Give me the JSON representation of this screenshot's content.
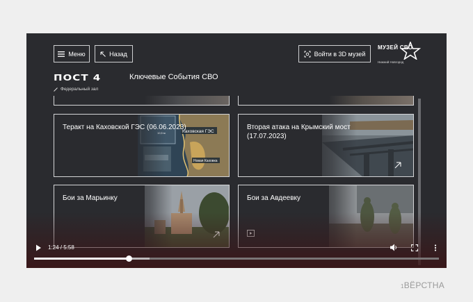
{
  "header": {
    "menu_label": "Меню",
    "back_label": "Назад",
    "museum3d_label": "Войти в 3D музей",
    "logo_text": "МУЗЕЙ СВО",
    "logo_city": "Нижний Новгород"
  },
  "page": {
    "post_title": "ПОСТ 4",
    "section_title": "Ключевые События СВО",
    "hall_label": "Федеральный зал"
  },
  "cards": [
    {
      "label": "Теракт на Каховской ГЭС (06.06.2023)"
    },
    {
      "label": "Вторая атака на Крымский мост (17.07.2023)"
    },
    {
      "label": "Бои за Марьинку"
    },
    {
      "label": "Бои за Авдеевку"
    }
  ],
  "map_labels": {
    "dam": "Каховская ГЭС",
    "city": "Новая Каховка",
    "dist": "10,5 м"
  },
  "player": {
    "time_display": "1:24 / 5:58",
    "progress": 0.235,
    "buffered": 0.285
  },
  "brand": "ВЁРСТНА",
  "brand_prefix": "1"
}
